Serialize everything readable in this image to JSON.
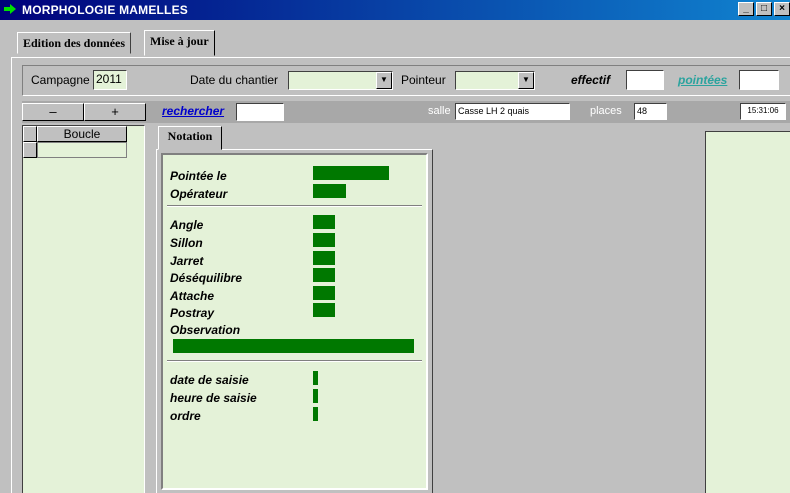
{
  "window": {
    "title": "MORPHOLOGIE MAMELLES",
    "controls": [
      "_",
      "□",
      "×"
    ]
  },
  "tabs": [
    {
      "label": "Edition des données"
    },
    {
      "label": "Mise à jour"
    }
  ],
  "header": {
    "campagne_label": "Campagne",
    "campagne_value": "2011",
    "date_label": "Date du chantier",
    "date_value": "",
    "pointeur_label": "Pointeur",
    "pointeur_value": "",
    "effectif_label": "effectif",
    "effectif_value": "",
    "pointees_label": "pointées",
    "pointees_value": ""
  },
  "toolbar": {
    "minus_label": "–",
    "plus_label": "+",
    "search_label": "rechercher",
    "search_value": "",
    "salle_label": "salle",
    "salle_value": "Casse LH 2 quais",
    "places_label": "places",
    "places_value": "48",
    "time_value": "15:31:06"
  },
  "list": {
    "column_header": "Boucle"
  },
  "notation": {
    "tab_label": "Notation",
    "group1": [
      "Pointée le",
      "Opérateur"
    ],
    "group2": [
      "Angle",
      "Sillon",
      "Jarret",
      "Déséquilibre",
      "Attache",
      "Postray",
      "Observation"
    ],
    "group3": [
      "date de saisie",
      "heure de saisie",
      "ordre"
    ]
  },
  "colors": {
    "field_bg": "#e4f2d8",
    "value_bar": "#007800",
    "title_bar": "#00007b",
    "link": "#2aa39e"
  }
}
